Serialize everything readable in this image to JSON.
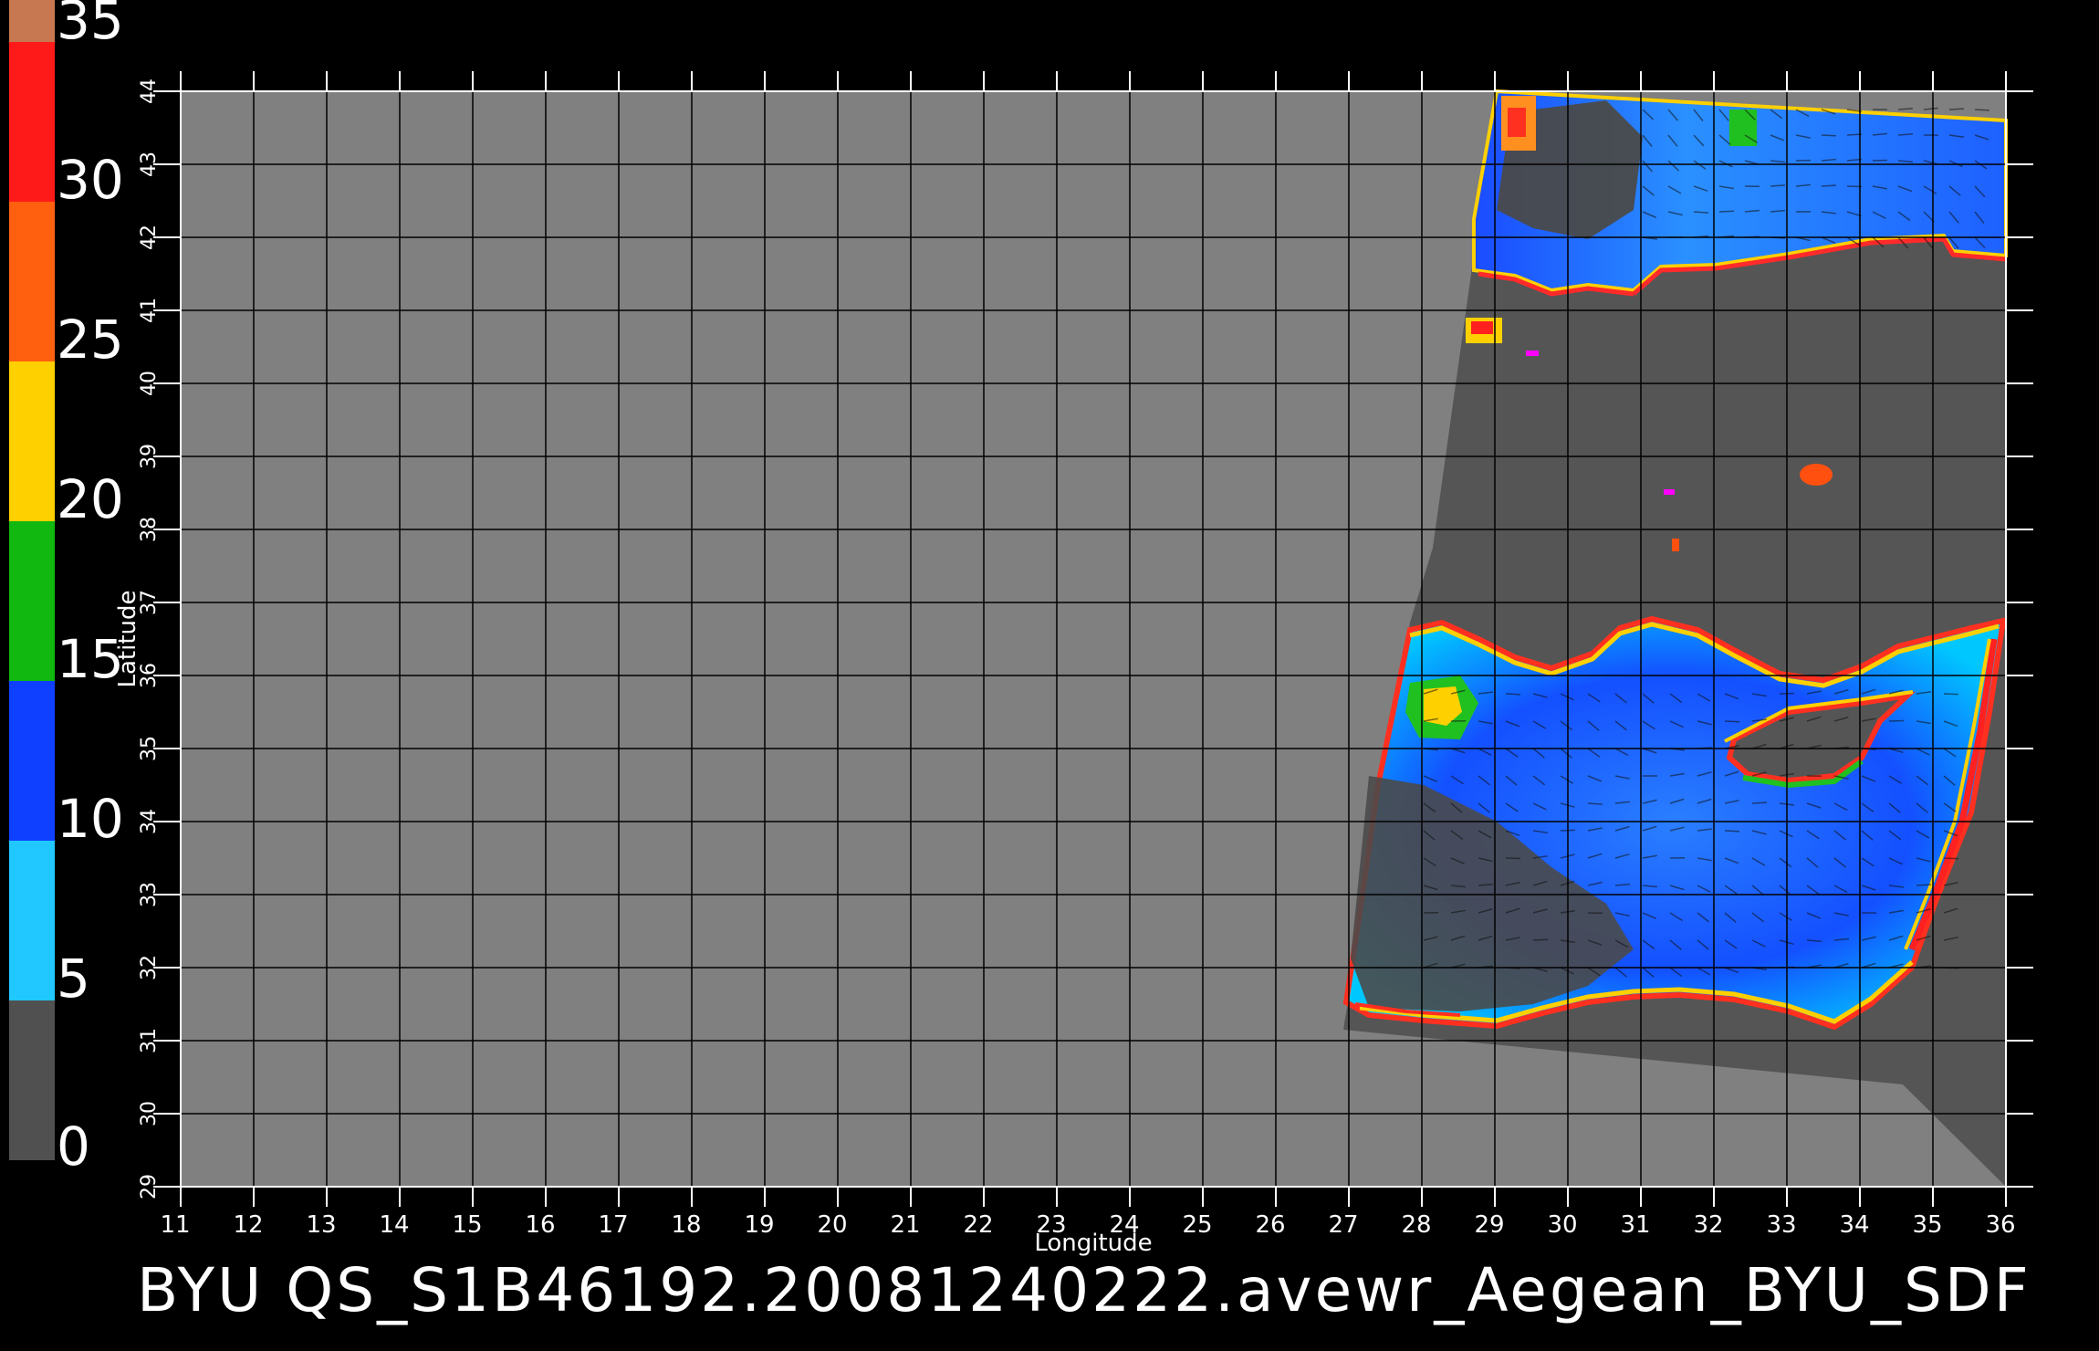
{
  "title": "BYU  QS_S1B46192.20081240222.avewr_Aegean_BYU_SDF",
  "colorbar": {
    "labels": [
      "35",
      "30",
      "25",
      "20",
      "15",
      "10",
      "5",
      "0"
    ]
  },
  "axes": {
    "x_label": "Longitude",
    "y_label": "Latitude",
    "x_ticks": [
      "11",
      "12",
      "13",
      "14",
      "15",
      "16",
      "17",
      "18",
      "19",
      "20",
      "21",
      "22",
      "23",
      "24",
      "25",
      "26",
      "27",
      "28",
      "29",
      "30",
      "31",
      "32",
      "33",
      "34",
      "35",
      "36"
    ],
    "y_ticks": [
      "29",
      "30",
      "31",
      "32",
      "33",
      "34",
      "35",
      "36",
      "37",
      "38",
      "39",
      "40",
      "41",
      "42",
      "43",
      "44"
    ]
  },
  "colors": {
    "background": "#000000",
    "map_background": "#808080",
    "swath_nodata": "#555555"
  }
}
